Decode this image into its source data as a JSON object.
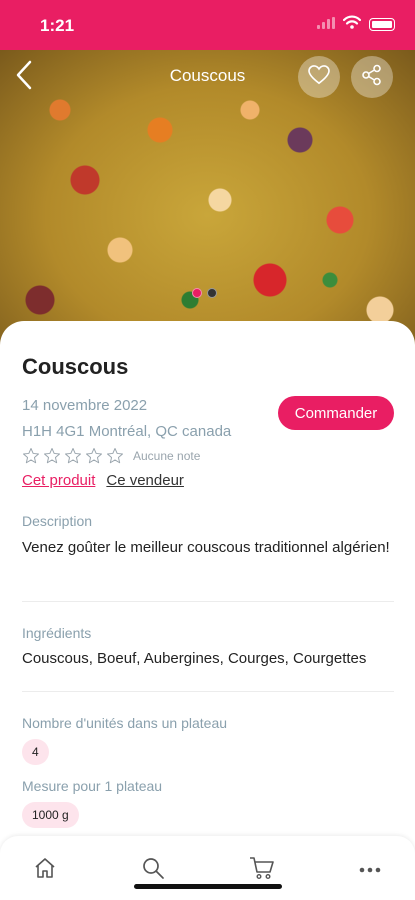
{
  "status_bar": {
    "time": "1:21"
  },
  "header": {
    "title": "Couscous"
  },
  "product": {
    "title": "Couscous",
    "date": "14 novembre 2022",
    "location": "H1H 4G1 Montréal, QC canada",
    "order_label": "Commander",
    "rating_text": "Aucune note",
    "rating_value": 0,
    "rating_max": 5,
    "link_product": "Cet produit",
    "link_seller": "Ce vendeur"
  },
  "description": {
    "label": "Description",
    "text": "Venez goûter le meilleur couscous traditionnel algérien!"
  },
  "ingredients": {
    "label": "Ingrédients",
    "text": "Couscous, Boeuf, Aubergines, Courges, Courgettes"
  },
  "units": {
    "label": "Nombre d'unités dans un plateau",
    "value": "4"
  },
  "measure": {
    "label": "Mesure pour 1 plateau",
    "value": "1000 g"
  },
  "carousel": {
    "count": 2,
    "active_index": 0
  },
  "colors": {
    "accent": "#e91e63",
    "muted": "#8aa0ad",
    "chip_bg": "#fde4ec"
  },
  "icons": {
    "back": "chevron-left-icon",
    "favorite": "heart-icon",
    "share": "share-icon",
    "tab_home": "home-icon",
    "tab_search": "search-icon",
    "tab_cart": "cart-icon",
    "tab_more": "more-icon"
  }
}
